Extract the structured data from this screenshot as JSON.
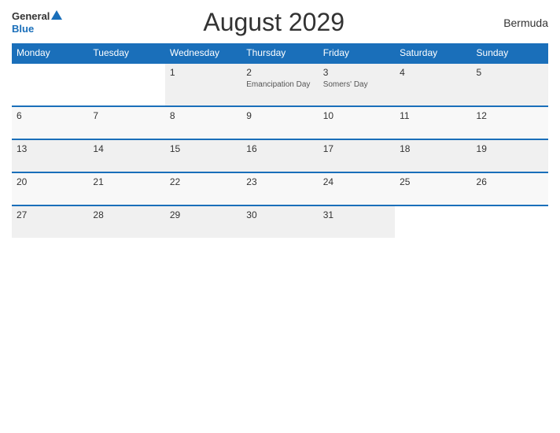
{
  "header": {
    "logo_general": "General",
    "logo_blue": "Blue",
    "title": "August 2029",
    "country": "Bermuda"
  },
  "weekdays": [
    "Monday",
    "Tuesday",
    "Wednesday",
    "Thursday",
    "Friday",
    "Saturday",
    "Sunday"
  ],
  "weeks": [
    [
      {
        "day": "",
        "holiday": ""
      },
      {
        "day": "",
        "holiday": ""
      },
      {
        "day": "1",
        "holiday": ""
      },
      {
        "day": "2",
        "holiday": "Emancipation Day"
      },
      {
        "day": "3",
        "holiday": "Somers' Day"
      },
      {
        "day": "4",
        "holiday": ""
      },
      {
        "day": "5",
        "holiday": ""
      }
    ],
    [
      {
        "day": "6",
        "holiday": ""
      },
      {
        "day": "7",
        "holiday": ""
      },
      {
        "day": "8",
        "holiday": ""
      },
      {
        "day": "9",
        "holiday": ""
      },
      {
        "day": "10",
        "holiday": ""
      },
      {
        "day": "11",
        "holiday": ""
      },
      {
        "day": "12",
        "holiday": ""
      }
    ],
    [
      {
        "day": "13",
        "holiday": ""
      },
      {
        "day": "14",
        "holiday": ""
      },
      {
        "day": "15",
        "holiday": ""
      },
      {
        "day": "16",
        "holiday": ""
      },
      {
        "day": "17",
        "holiday": ""
      },
      {
        "day": "18",
        "holiday": ""
      },
      {
        "day": "19",
        "holiday": ""
      }
    ],
    [
      {
        "day": "20",
        "holiday": ""
      },
      {
        "day": "21",
        "holiday": ""
      },
      {
        "day": "22",
        "holiday": ""
      },
      {
        "day": "23",
        "holiday": ""
      },
      {
        "day": "24",
        "holiday": ""
      },
      {
        "day": "25",
        "holiday": ""
      },
      {
        "day": "26",
        "holiday": ""
      }
    ],
    [
      {
        "day": "27",
        "holiday": ""
      },
      {
        "day": "28",
        "holiday": ""
      },
      {
        "day": "29",
        "holiday": ""
      },
      {
        "day": "30",
        "holiday": ""
      },
      {
        "day": "31",
        "holiday": ""
      },
      {
        "day": "",
        "holiday": ""
      },
      {
        "day": "",
        "holiday": ""
      }
    ]
  ]
}
